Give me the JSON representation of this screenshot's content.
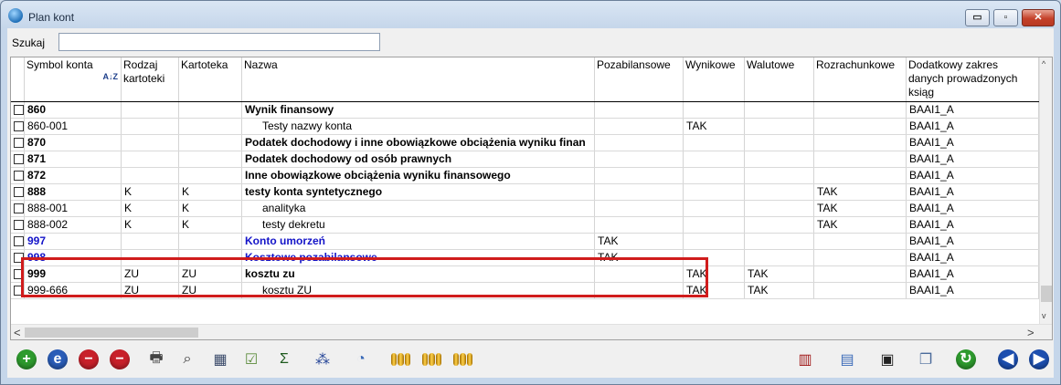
{
  "window": {
    "title": "Plan kont",
    "controls": {
      "minimize": "▭",
      "maximize": "▫",
      "close": "✕"
    }
  },
  "search": {
    "label": "Szukaj",
    "value": "",
    "placeholder": ""
  },
  "table": {
    "columns": [
      {
        "key": "symbol",
        "label": "Symbol konta"
      },
      {
        "key": "rodzaj",
        "label": "Rodzaj kartoteki"
      },
      {
        "key": "kartoteka",
        "label": "Kartoteka"
      },
      {
        "key": "nazwa",
        "label": "Nazwa"
      },
      {
        "key": "pozabil",
        "label": "Pozabilansowe"
      },
      {
        "key": "wynik",
        "label": "Wynikowe"
      },
      {
        "key": "walut",
        "label": "Walutowe"
      },
      {
        "key": "rozrach",
        "label": "Rozrachunkowe"
      },
      {
        "key": "dodatk",
        "label": "Dodatkowy zakres danych prowadzonych ksiąg"
      }
    ],
    "sort_icon": "A↓Z",
    "rows": [
      {
        "symbol": "860",
        "rodzaj": "",
        "kartoteka": "",
        "nazwa": "Wynik finansowy",
        "pozabil": "",
        "wynik": "",
        "walut": "",
        "rozrach": "",
        "dodatk": "BAAI1_A",
        "bold": true,
        "indent": false,
        "highlighted": false
      },
      {
        "symbol": "860-001",
        "rodzaj": "",
        "kartoteka": "",
        "nazwa": "Testy nazwy konta",
        "pozabil": "",
        "wynik": "TAK",
        "walut": "",
        "rozrach": "",
        "dodatk": "BAAI1_A",
        "bold": false,
        "indent": true,
        "highlighted": false
      },
      {
        "symbol": "870",
        "rodzaj": "",
        "kartoteka": "",
        "nazwa": "Podatek dochodowy i inne obowiązkowe obciążenia wyniku finan",
        "pozabil": "",
        "wynik": "",
        "walut": "",
        "rozrach": "",
        "dodatk": "BAAI1_A",
        "bold": true,
        "indent": false,
        "highlighted": false
      },
      {
        "symbol": "871",
        "rodzaj": "",
        "kartoteka": "",
        "nazwa": "Podatek dochodowy od osób prawnych",
        "pozabil": "",
        "wynik": "",
        "walut": "",
        "rozrach": "",
        "dodatk": "BAAI1_A",
        "bold": true,
        "indent": false,
        "highlighted": false
      },
      {
        "symbol": "872",
        "rodzaj": "",
        "kartoteka": "",
        "nazwa": "Inne obowiązkowe obciążenia wyniku finansowego",
        "pozabil": "",
        "wynik": "",
        "walut": "",
        "rozrach": "",
        "dodatk": "BAAI1_A",
        "bold": true,
        "indent": false,
        "highlighted": false
      },
      {
        "symbol": "888",
        "rodzaj": "K",
        "kartoteka": "K",
        "nazwa": "testy konta syntetycznego",
        "pozabil": "",
        "wynik": "",
        "walut": "",
        "rozrach": "TAK",
        "dodatk": "BAAI1_A",
        "bold": true,
        "indent": false,
        "highlighted": false
      },
      {
        "symbol": "888-001",
        "rodzaj": "K",
        "kartoteka": "K",
        "nazwa": "analityka",
        "pozabil": "",
        "wynik": "",
        "walut": "",
        "rozrach": "TAK",
        "dodatk": "BAAI1_A",
        "bold": false,
        "indent": true,
        "highlighted": false
      },
      {
        "symbol": "888-002",
        "rodzaj": "K",
        "kartoteka": "K",
        "nazwa": "testy dekretu",
        "pozabil": "",
        "wynik": "",
        "walut": "",
        "rozrach": "TAK",
        "dodatk": "BAAI1_A",
        "bold": false,
        "indent": true,
        "highlighted": false
      },
      {
        "symbol": "997",
        "rodzaj": "",
        "kartoteka": "",
        "nazwa": "Konto umorzeń",
        "pozabil": "TAK",
        "wynik": "",
        "walut": "",
        "rozrach": "",
        "dodatk": "BAAI1_A",
        "bold": true,
        "indent": false,
        "highlighted": true
      },
      {
        "symbol": "998",
        "rodzaj": "",
        "kartoteka": "",
        "nazwa": "Kosztowe pozabilansowe",
        "pozabil": "TAK",
        "wynik": "",
        "walut": "",
        "rozrach": "",
        "dodatk": "BAAI1_A",
        "bold": true,
        "indent": false,
        "highlighted": true
      },
      {
        "symbol": "999",
        "rodzaj": "ZU",
        "kartoteka": "ZU",
        "nazwa": "kosztu zu",
        "pozabil": "",
        "wynik": "TAK",
        "walut": "TAK",
        "rozrach": "",
        "dodatk": "BAAI1_A",
        "bold": true,
        "indent": false,
        "highlighted": false
      },
      {
        "symbol": "999-666",
        "rodzaj": "ZU",
        "kartoteka": "ZU",
        "nazwa": "kosztu ZU",
        "pozabil": "",
        "wynik": "TAK",
        "walut": "TAK",
        "rozrach": "",
        "dodatk": "BAAI1_A",
        "bold": false,
        "indent": true,
        "highlighted": false
      }
    ]
  },
  "scroll": {
    "left": "<",
    "right": ">",
    "up": "^",
    "down": "v"
  },
  "toolbar_left": [
    {
      "name": "add-icon",
      "glyph": "+",
      "color": "#2e9b2e"
    },
    {
      "name": "edit-icon",
      "glyph": "e",
      "color": "#2a5db8"
    },
    {
      "name": "delete-icon",
      "glyph": "−",
      "color": "#c8202a"
    },
    {
      "name": "delete-many-icon",
      "glyph": "−",
      "color": "#c8202a"
    },
    {
      "name": "print-icon",
      "glyph": "🖶",
      "color": "#444444"
    },
    {
      "name": "binoculars-icon",
      "glyph": "⌕",
      "color": "#333333"
    },
    {
      "name": "table-icon",
      "glyph": "▦",
      "color": "#3a4a6a"
    },
    {
      "name": "checklist-icon",
      "glyph": "☑",
      "color": "#5a8a3a"
    },
    {
      "name": "sigma-icon",
      "glyph": "Σ",
      "color": "#1e5a1e"
    },
    {
      "name": "tree-icon",
      "glyph": "⁂",
      "color": "#2b4a9a"
    },
    {
      "name": "chart-window-icon",
      "glyph": "◔",
      "color": "#3a6ab8"
    },
    {
      "name": "coins-icon-1",
      "glyph": "",
      "color": "#c99a10"
    },
    {
      "name": "coins-icon-2",
      "glyph": "",
      "color": "#c99a10"
    },
    {
      "name": "coins-icon-3",
      "glyph": "",
      "color": "#c99a10"
    }
  ],
  "toolbar_right": [
    {
      "name": "report-chart-icon",
      "glyph": "▥",
      "color": "#a01818"
    },
    {
      "name": "document-icon",
      "glyph": "▤",
      "color": "#3a6ab8"
    },
    {
      "name": "save-icon",
      "glyph": "▣",
      "color": "#222222"
    },
    {
      "name": "copy-windows-icon",
      "glyph": "❐",
      "color": "#4a6a9a"
    },
    {
      "name": "refresh-icon",
      "glyph": "↻",
      "color": "#2e9b2e"
    },
    {
      "name": "previous-icon",
      "glyph": "◀",
      "color": "#1d4fb0"
    },
    {
      "name": "next-icon",
      "glyph": "▶",
      "color": "#1d4fb0"
    }
  ],
  "colors": {
    "accent_blue": "#1414c8",
    "highlight_red": "#d01c1c"
  }
}
